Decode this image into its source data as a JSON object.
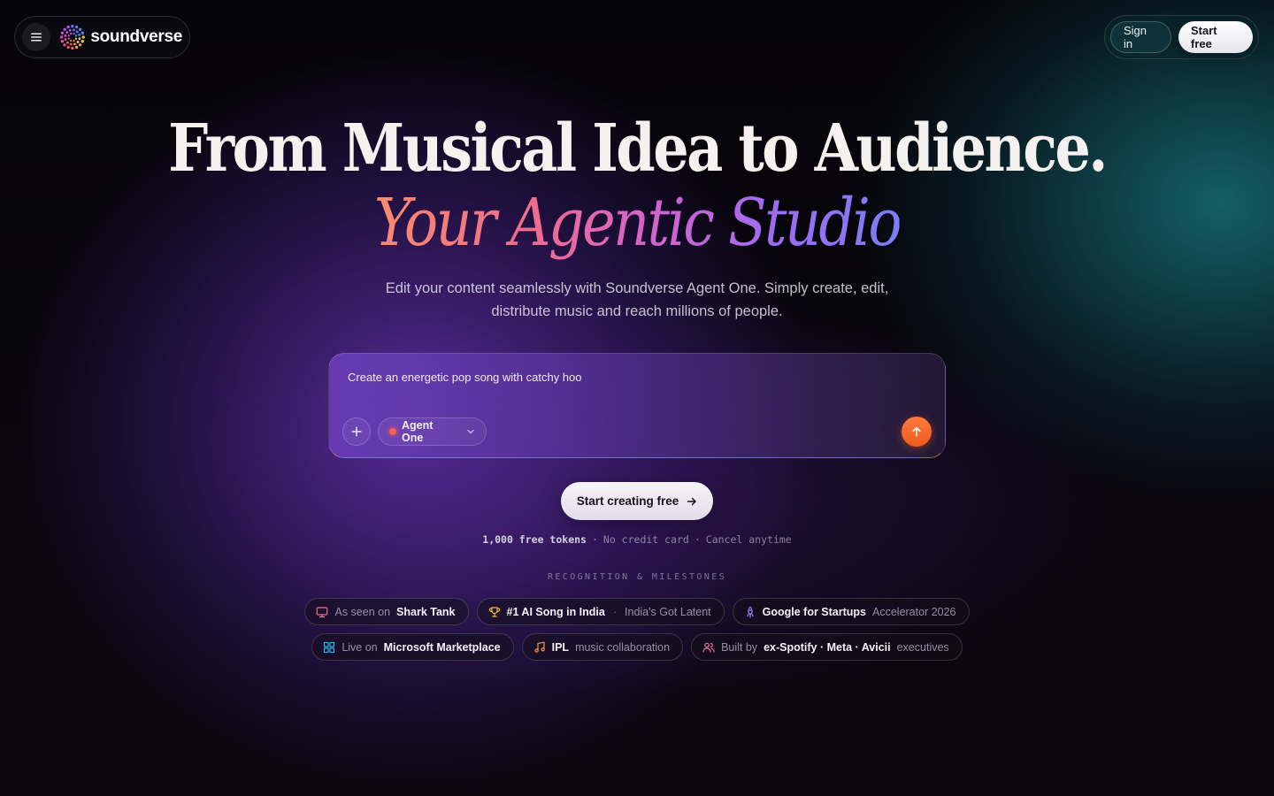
{
  "nav": {
    "brand": "soundverse",
    "sign_in": "Sign in",
    "start_free": "Start free"
  },
  "hero": {
    "title": "From Musical Idea to Audience.",
    "subtitle": "Your Agentic Studio",
    "description_line1": "Edit your content seamlessly with Soundverse Agent One. Simply create, edit,",
    "description_line2": "distribute music and reach millions of people."
  },
  "prompt": {
    "text": "Create an energetic pop song with catchy hoo",
    "agent_label": "Agent One"
  },
  "cta": {
    "label": "Start creating free"
  },
  "fineprint": {
    "tokens": "1,000 free tokens",
    "no_card": "No credit card",
    "cancel": "Cancel anytime",
    "separator": "·"
  },
  "recognition": {
    "heading": "RECOGNITION & MILESTONES",
    "badges": [
      {
        "pre": "As seen on",
        "bold": "Shark Tank",
        "icon": "tv-icon",
        "icon_color": "#ef6c8e"
      },
      {
        "bold": "#1 AI Song in India",
        "sep": "·",
        "post": "India's Got Latent",
        "icon": "trophy-icon",
        "icon_color": "#f5b731"
      },
      {
        "bold": "Google for Startups",
        "post": "Accelerator 2026",
        "icon": "rocket-icon",
        "icon_color": "#9a7cf6"
      },
      {
        "pre": "Live on",
        "bold": "Microsoft Marketplace",
        "icon": "grid-icon",
        "icon_color": "#2fb5e8"
      },
      {
        "bold": "IPL",
        "post": "music collaboration",
        "icon": "music-note-icon",
        "icon_color": "#f59a3c"
      },
      {
        "pre": "Built by",
        "bold": "ex-Spotify · Meta · Avicii",
        "post": "executives",
        "icon": "users-icon",
        "icon_color": "#ef6c9e"
      }
    ]
  }
}
